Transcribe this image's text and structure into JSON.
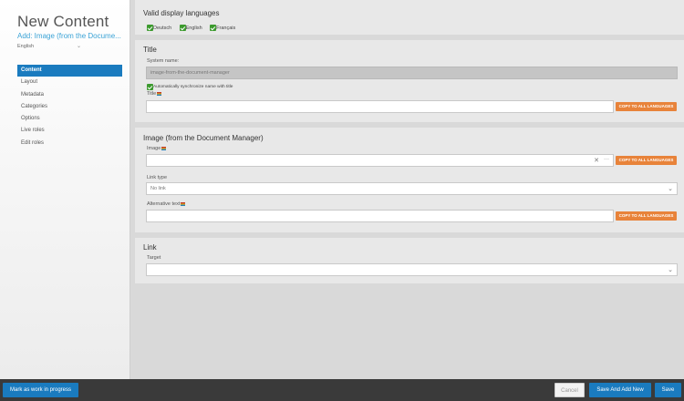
{
  "sidebar": {
    "title": "New Content",
    "subtitle": "Add: Image (from the Docume...",
    "language": "English",
    "nav": [
      "Content",
      "Layout",
      "Metadata",
      "Categories",
      "Options",
      "Live roles",
      "Edit roles"
    ]
  },
  "languages": {
    "heading": "Valid display languages",
    "items": [
      "Deutsch",
      "English",
      "Français"
    ]
  },
  "title_section": {
    "heading": "Title",
    "system_name_label": "System name:",
    "system_name_value": "image-from-the-document-manager",
    "sync_label": "Automatically synchronize name with title",
    "title_label": "Title",
    "copy_label": "COPY TO ALL LANGUAGES"
  },
  "image_section": {
    "heading": "Image (from the Document Manager)",
    "image_label": "Image",
    "link_type_label": "Link type",
    "link_type_value": "No link",
    "alt_label": "Alternative text",
    "copy_label": "COPY TO ALL LANGUAGES"
  },
  "link_section": {
    "heading": "Link",
    "target_label": "Target"
  },
  "footer": {
    "wip_label": "Mark as work in progress",
    "cancel_label": "Cancel",
    "save_add_label": "Save And Add New",
    "save_label": "Save"
  },
  "colors": {
    "accent_blue": "#1a7bbf",
    "copy_orange": "#e8833a",
    "check_green": "#3c9a2e",
    "link_blue": "#3aa3d6"
  },
  "icons": {
    "language_chevron": "chevron-down-icon",
    "clear": "close-icon",
    "more": "ellipsis-icon",
    "select_chevron": "chevron-down-icon",
    "flag": "language-flag-icon",
    "check": "checkbox-checked-icon"
  }
}
